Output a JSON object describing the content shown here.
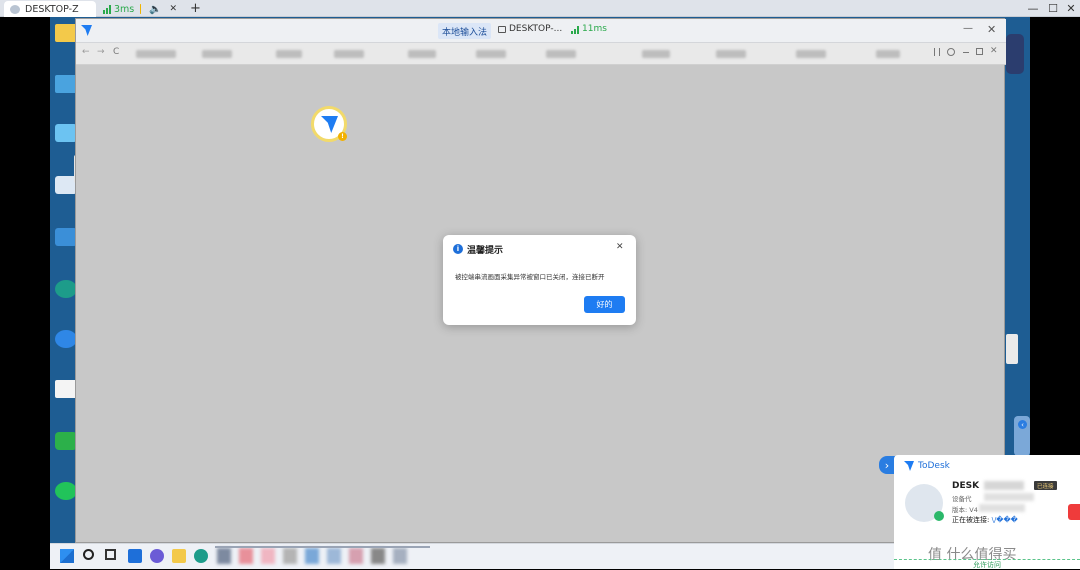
{
  "host": {
    "tabs": [
      {
        "label": "DESKTOP-Z",
        "active": true
      },
      {
        "label": "3ms",
        "active": false
      }
    ],
    "new_tab": "+",
    "close_glyph": "✕",
    "win_minimize": "—",
    "win_maximize": "☐",
    "win_close": "✕"
  },
  "todesk_window": {
    "ime_label": "本地输入法",
    "device_label": "DESKTOP-...",
    "latency": "11ms",
    "min_glyph": "—",
    "close_glyph": "✕",
    "nav_back": "←",
    "nav_forward": "→",
    "nav_reload": "C"
  },
  "dialog": {
    "title": "温馨提示",
    "message": "被控端串流画面采集异常被窗口已关闭，连接已断开",
    "ok_label": "好的",
    "close_glyph": "✕",
    "info_glyph": "i"
  },
  "popup": {
    "brand": "ToDesk",
    "device_name": "DESK",
    "badge": "已连接",
    "device_code_label": "设备代",
    "version_label": "版本: V4",
    "status_label": "正在被连接: ",
    "status_value": "\\/���",
    "allow_label": "允许访问",
    "chevron": "›"
  },
  "watermark": "值 什么值得买",
  "colors": {
    "accent": "#1e7cf2",
    "signal_green": "#2aa94b",
    "desktop_blue": "#1e5d93"
  }
}
